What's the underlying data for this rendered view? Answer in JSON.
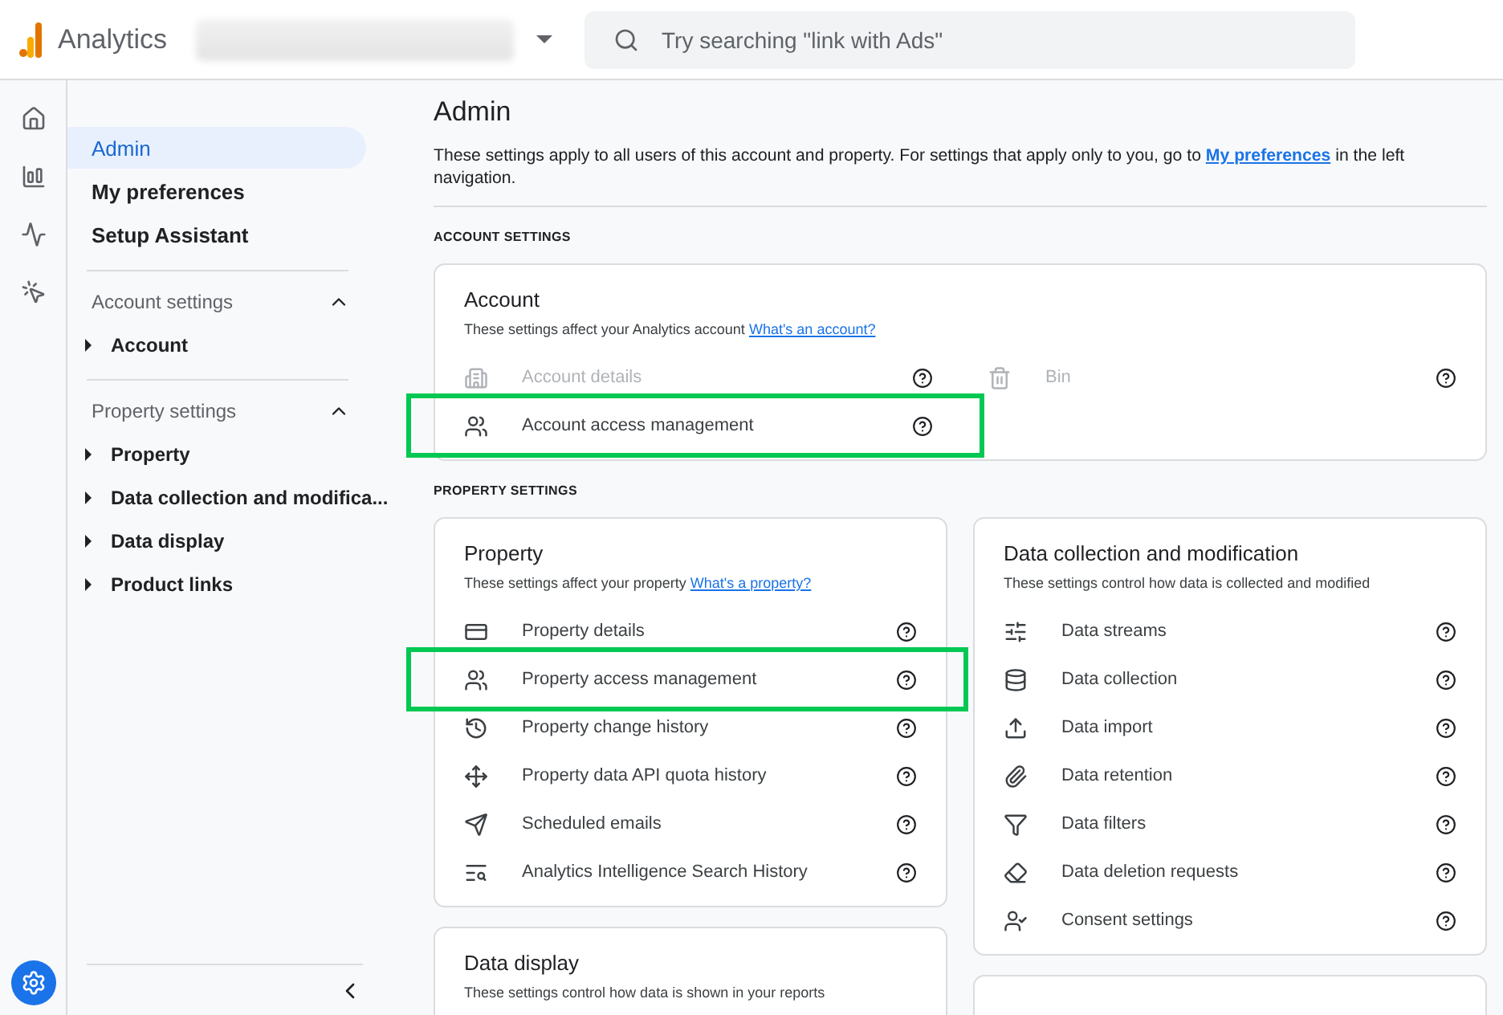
{
  "app": {
    "name": "Analytics"
  },
  "search": {
    "placeholder": "Try searching \"link with Ads\""
  },
  "nav": {
    "items": [
      {
        "label": "Admin",
        "selected": true
      },
      {
        "label": "My preferences",
        "selected": false
      },
      {
        "label": "Setup Assistant",
        "selected": false
      }
    ],
    "sections": [
      {
        "title": "Account settings",
        "expanded": true,
        "items": [
          {
            "label": "Account"
          }
        ]
      },
      {
        "title": "Property settings",
        "expanded": true,
        "items": [
          {
            "label": "Property"
          },
          {
            "label": "Data collection and modifica..."
          },
          {
            "label": "Data display"
          },
          {
            "label": "Product links"
          }
        ]
      }
    ]
  },
  "page": {
    "title": "Admin",
    "intro": "These settings apply to all users of this account and property. For settings that apply only to you, go to",
    "intro_link": "My preferences",
    "intro_end": "in the left navigation."
  },
  "account_section": {
    "heading": "ACCOUNT SETTINGS",
    "card": {
      "title": "Account",
      "description": "These settings affect your Analytics account",
      "link": "What's an account?",
      "rows": [
        {
          "label": "Account details",
          "disabled": true,
          "highlighted": false
        },
        {
          "label": "Bin",
          "disabled": true,
          "highlighted": false
        },
        {
          "label": "Account access management",
          "disabled": false,
          "highlighted": true
        }
      ]
    }
  },
  "property_section": {
    "heading": "PROPERTY SETTINGS",
    "columns": [
      [
        {
          "title": "Property",
          "description": "These settings affect your property",
          "link": "What's a property?",
          "rows": [
            {
              "label": "Property details",
              "disabled": false,
              "highlighted": false
            },
            {
              "label": "Property access management",
              "disabled": false,
              "highlighted": true
            },
            {
              "label": "Property change history",
              "disabled": false,
              "highlighted": false
            },
            {
              "label": "Property data API quota history",
              "disabled": false,
              "highlighted": false
            },
            {
              "label": "Scheduled emails",
              "disabled": false,
              "highlighted": false
            },
            {
              "label": "Analytics Intelligence Search History",
              "disabled": false,
              "highlighted": false
            }
          ]
        },
        {
          "title": "Data display",
          "description": "These settings control how data is shown in your reports"
        }
      ],
      [
        {
          "title": "Data collection and modification",
          "description": "These settings control how data is collected and modified",
          "rows": [
            {
              "label": "Data streams",
              "disabled": false,
              "highlighted": false
            },
            {
              "label": "Data collection",
              "disabled": false,
              "highlighted": false
            },
            {
              "label": "Data import",
              "disabled": false,
              "highlighted": false
            },
            {
              "label": "Data retention",
              "disabled": false,
              "highlighted": false
            },
            {
              "label": "Data filters",
              "disabled": false,
              "highlighted": false
            },
            {
              "label": "Data deletion requests",
              "disabled": false,
              "highlighted": false
            },
            {
              "label": "Consent settings",
              "disabled": false,
              "highlighted": false
            }
          ]
        }
      ]
    ]
  }
}
